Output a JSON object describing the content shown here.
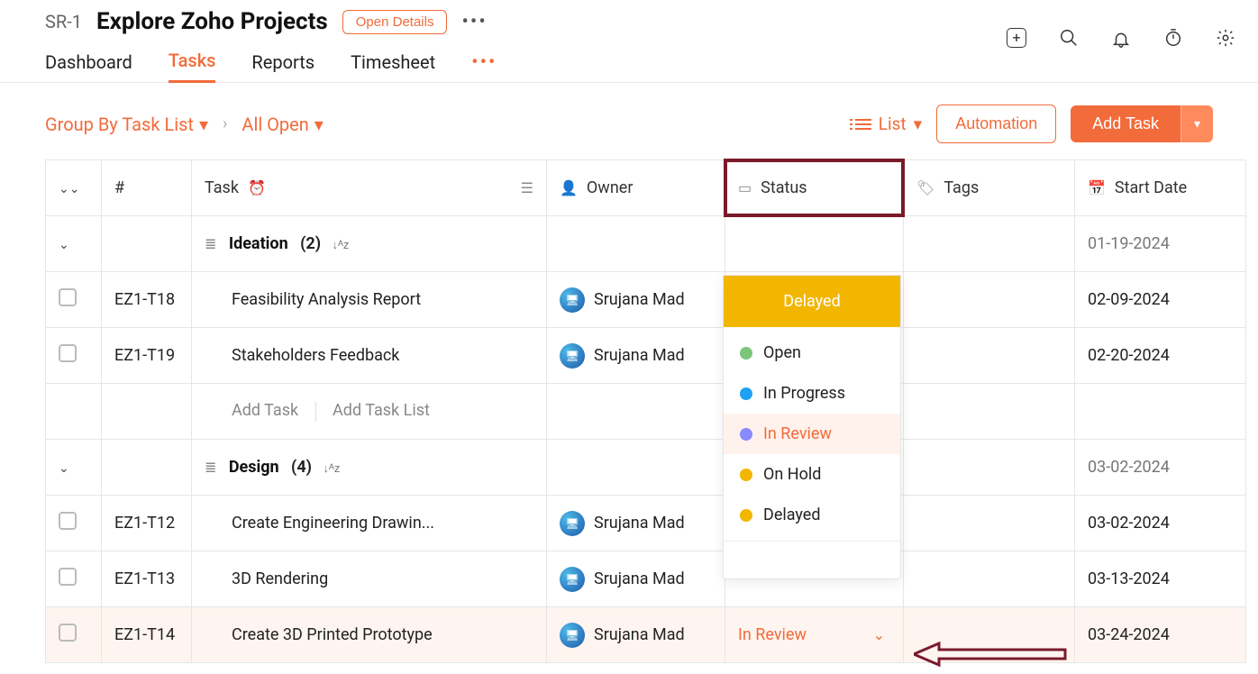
{
  "header": {
    "sr": "SR-1",
    "title": "Explore Zoho Projects",
    "open_details": "Open Details"
  },
  "tabs": {
    "dashboard": "Dashboard",
    "tasks": "Tasks",
    "reports": "Reports",
    "timesheet": "Timesheet"
  },
  "controls": {
    "group_by": "Group By Task List",
    "filter": "All Open",
    "view": "List",
    "automation": "Automation",
    "add_task": "Add Task"
  },
  "columns": {
    "id": "#",
    "task": "Task",
    "owner": "Owner",
    "status": "Status",
    "tags": "Tags",
    "start_date": "Start Date"
  },
  "groups": [
    {
      "name": "Ideation",
      "count": "(2)",
      "date": "01-19-2024"
    },
    {
      "name": "Design",
      "count": "(4)",
      "date": "03-02-2024"
    }
  ],
  "tasks_g1": [
    {
      "id": "EZ1-T18",
      "name": "Feasibility Analysis Report",
      "owner": "Srujana Mad",
      "date": "02-09-2024"
    },
    {
      "id": "EZ1-T19",
      "name": "Stakeholders Feedback",
      "owner": "Srujana Mad",
      "date": "02-20-2024"
    }
  ],
  "tasks_g2": [
    {
      "id": "EZ1-T12",
      "name": "Create Engineering Drawin...",
      "owner": "Srujana Mad",
      "date": "03-02-2024"
    },
    {
      "id": "EZ1-T13",
      "name": "3D Rendering",
      "owner": "Srujana Mad",
      "date": "03-13-2024"
    },
    {
      "id": "EZ1-T14",
      "name": "Create 3D Printed Prototype",
      "owner": "Srujana Mad",
      "date": "03-24-2024",
      "status": "In Review"
    }
  ],
  "addrow": {
    "add_task": "Add Task",
    "add_task_list": "Add Task List"
  },
  "status_dropdown": {
    "current": "Delayed",
    "options": [
      {
        "label": "Open",
        "color": "#7bc67b"
      },
      {
        "label": "In Progress",
        "color": "#1ea1f2"
      },
      {
        "label": "In Review",
        "color": "#8a8aff",
        "hov": true
      },
      {
        "label": "On Hold",
        "color": "#f2b600"
      },
      {
        "label": "Delayed",
        "color": "#f2b600"
      }
    ],
    "search_value": ""
  }
}
